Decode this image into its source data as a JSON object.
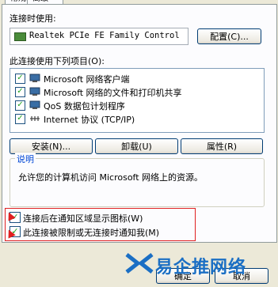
{
  "tabs": {
    "active": "常规",
    "other": "高级"
  },
  "connect_using_label": "连接时使用:",
  "adapter_name": "Realtek PCIe FE Family Control",
  "configure_button": "配置(C)...",
  "items_label": "此连接使用下列项目(O):",
  "items": [
    {
      "label": "Microsoft 网络客户端",
      "checked": true,
      "icon": "network-client-icon"
    },
    {
      "label": "Microsoft 网络的文件和打印机共享",
      "checked": true,
      "icon": "printer-share-icon"
    },
    {
      "label": "QoS 数据包计划程序",
      "checked": true,
      "icon": "qos-icon"
    },
    {
      "label": "Internet 协议 (TCP/IP)",
      "checked": true,
      "icon": "protocol-icon"
    }
  ],
  "install_button": "安装(N)...",
  "uninstall_button": "卸载(U)",
  "properties_button": "属性(R)",
  "description_legend": "说明",
  "description_text": "允许您的计算机访问 Microsoft 网络上的资源。",
  "show_icon_label": "连接后在通知区域显示图标(W)",
  "notify_label": "此连接被限制或无连接时通知我(M)",
  "ok_button": "确定",
  "cancel_button": "取消",
  "watermark": "易企推网络",
  "colors": {
    "highlight": "#e02020",
    "accent": "#0046d5",
    "check": "#21a121"
  }
}
